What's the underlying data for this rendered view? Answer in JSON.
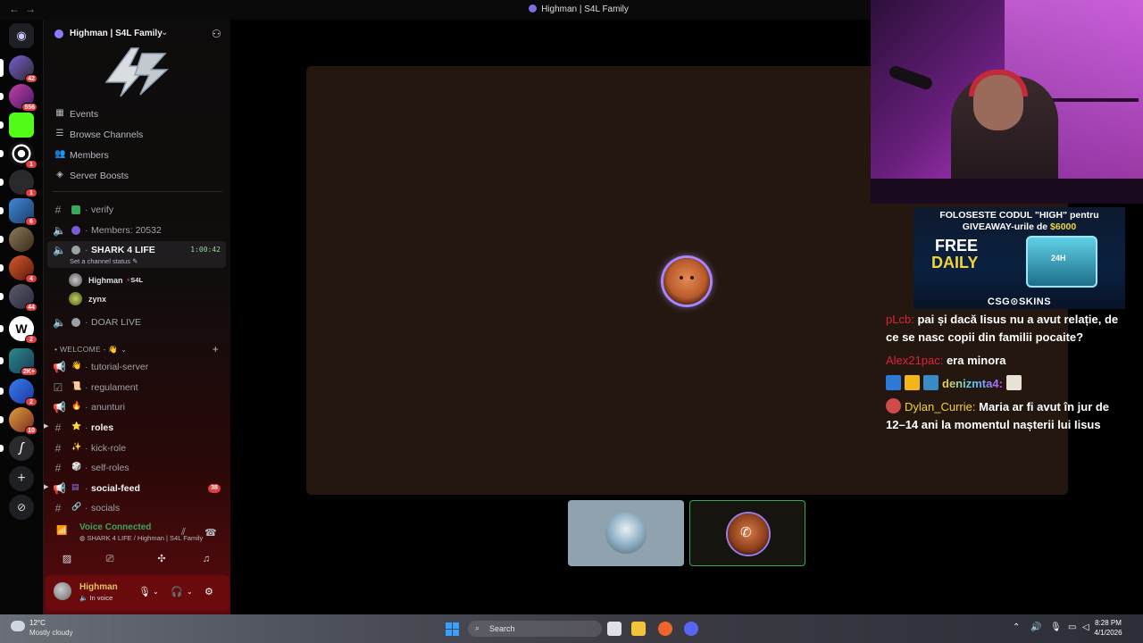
{
  "window": {
    "title": "Highman | S4L Family",
    "back_glyph": "←",
    "forward_glyph": "→"
  },
  "rail": {
    "badges": [
      "42",
      "556",
      "1",
      "1",
      "6",
      "4",
      "44",
      "2",
      "2K+",
      "2",
      "10"
    ]
  },
  "guild": {
    "name": "Highman | S4L Family",
    "chevron": "⌄",
    "menu": [
      {
        "label": "Events",
        "icon": "calendar-icon",
        "glyph": "▦"
      },
      {
        "label": "Browse Channels",
        "icon": "channels-icon",
        "glyph": "☰"
      },
      {
        "label": "Members",
        "icon": "members-icon",
        "glyph": "👥"
      },
      {
        "label": "Server Boosts",
        "icon": "boost-icon",
        "glyph": "◈"
      }
    ]
  },
  "channels": {
    "verify": "verify",
    "members": "Members: 20532",
    "shark": "SHARK 4 LIFE",
    "shark_timer": "1:00:42",
    "shark_status": "Set a channel status",
    "voice_users": [
      {
        "name": "Highman",
        "tag": "S4L"
      },
      {
        "name": "zynx"
      }
    ],
    "doar_live": "DOAR LIVE",
    "category": "WELCOME - 👋",
    "list": [
      {
        "label": "tutorial-server",
        "emoji": "👋"
      },
      {
        "label": "regulament",
        "emoji": "📜"
      },
      {
        "label": "anunturi",
        "emoji": "🔥"
      },
      {
        "label": "roles",
        "emoji": "⭐"
      },
      {
        "label": "kick-role",
        "emoji": "✨"
      },
      {
        "label": "self-roles",
        "emoji": "🎲"
      },
      {
        "label": "social-feed",
        "emoji": "▤",
        "count": "38"
      },
      {
        "label": "socials",
        "emoji": "🔗"
      }
    ]
  },
  "voice_panel": {
    "status": "Voice Connected",
    "location": "SHARK 4 LIFE / Highman | S4L Family"
  },
  "user": {
    "name": "Highman",
    "status": "In voice"
  },
  "ad": {
    "line1": "FOLOSESTE CODUL \"HIGH\" pentru",
    "line2_prefix": "GIVEAWAY-urile de ",
    "line2_amount": "$6000",
    "free": "FREE",
    "daily": "DAILY",
    "crate": "24H",
    "brand": "CSG⊙SKINS"
  },
  "chat": [
    {
      "user": "pLcb:",
      "color": "#e0213a",
      "text": "pai și dacă Iisus nu a avut relație, de ce se nasc copii din familii pocaite?"
    },
    {
      "user": "Alex21pac:",
      "color": "#e0213a",
      "text": "era minora"
    },
    {
      "user": "denizmta4:",
      "color": "gradient",
      "text": ""
    },
    {
      "user": "Dylan_Currie:",
      "color": "#f2d33a",
      "text": "Maria ar fi avut în jur de 12–14 ani la momentul nașterii lui Iisus"
    }
  ],
  "taskbar": {
    "temp": "12°C",
    "weather": "Mostly cloudy",
    "search": "Search",
    "time": "8:28 PM",
    "date": "4/1/2026"
  }
}
